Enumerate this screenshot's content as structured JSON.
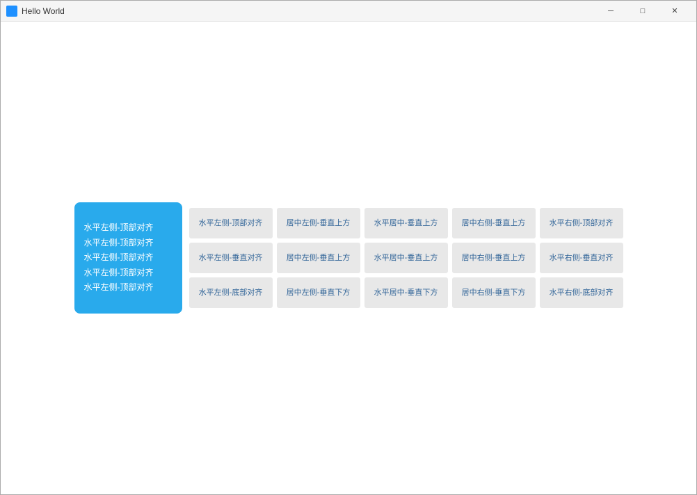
{
  "titlebar": {
    "title": "Hello World",
    "minimize_label": "─",
    "maximize_label": "□",
    "close_label": "✕"
  },
  "blue_panel": {
    "items": [
      "水平左侧-顶部对齐",
      "水平左侧-顶部对齐",
      "水平左侧-顶部对齐",
      "水平左侧-顶部对齐",
      "水平左侧-顶部对齐"
    ]
  },
  "grid": {
    "rows": [
      [
        "水平左侧-顶部对齐",
        "居中左侧-垂直上方",
        "水平居中-垂直上方",
        "居中右侧-垂直上方",
        "水平右侧-顶部对齐"
      ],
      [
        "水平左侧-垂直对齐",
        "居中左侧-垂直上方",
        "水平居中-垂直上方",
        "居中右侧-垂直上方",
        "水平右侧-垂直对齐"
      ],
      [
        "水平左侧-底部对齐",
        "居中左侧-垂直下方",
        "水平居中-垂直下方",
        "居中右侧-垂直下方",
        "水平右侧-底部对齐"
      ]
    ]
  }
}
